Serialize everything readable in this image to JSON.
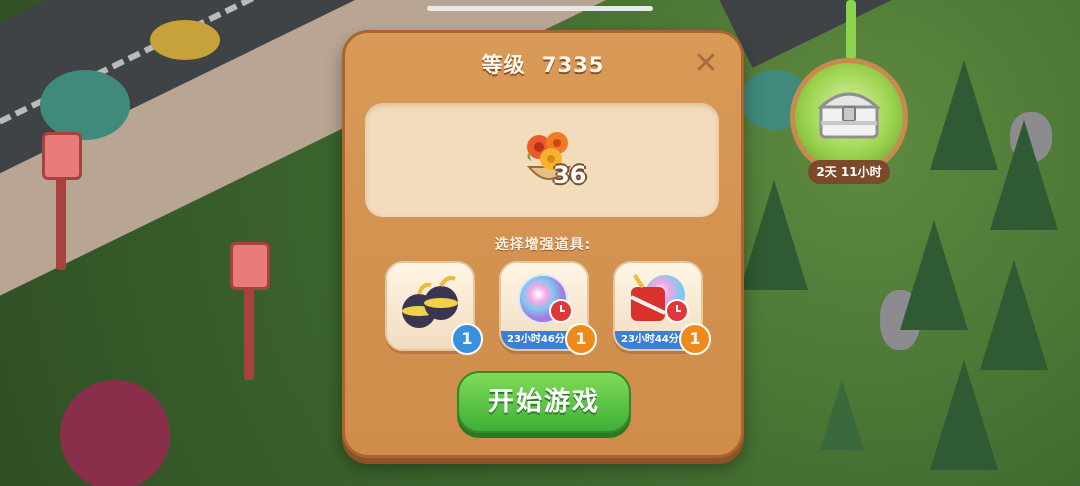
{
  "title": {
    "prefix": "等级",
    "level": "7335"
  },
  "reward": {
    "count": "36",
    "icon": "flower-pot-icon"
  },
  "subtitle": "选择增强道具:",
  "boosters": [
    {
      "icon": "bomb-pair-icon",
      "count": "1",
      "timer": ""
    },
    {
      "icon": "rainbow-orb-icon",
      "count": "1",
      "timer": "23小时46分"
    },
    {
      "icon": "firecracker-rainbow-icon",
      "count": "1",
      "timer": "23小时44分"
    }
  ],
  "play_button": "开始游戏",
  "chest": {
    "label": "2天 11小时",
    "icon": "treasure-chest-icon"
  },
  "colors": {
    "panel": "#d99a57",
    "play": "#4cbf3e",
    "timer_strip": "#3b7fd6"
  }
}
